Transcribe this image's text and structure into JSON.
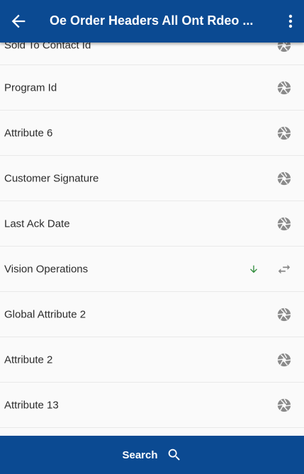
{
  "header": {
    "title": "Oe Order Headers All Ont Rdeo  ...",
    "back_icon": "arrow-left-icon",
    "menu_icon": "more-vert-icon"
  },
  "rows": [
    {
      "label": "Sold To Contact Id",
      "icon": "aperture-icon"
    },
    {
      "label": "Program Id",
      "icon": "aperture-icon"
    },
    {
      "label": "Attribute 6",
      "icon": "aperture-icon"
    },
    {
      "label": "Customer Signature",
      "icon": "aperture-icon"
    },
    {
      "label": "Last Ack Date",
      "icon": "aperture-icon"
    },
    {
      "label": "Vision Operations",
      "icon": "swap-horiz-icon",
      "sort_icon": "arrow-down-icon"
    },
    {
      "label": "Global Attribute 2",
      "icon": "aperture-icon"
    },
    {
      "label": "Attribute 2",
      "icon": "aperture-icon"
    },
    {
      "label": "Attribute 13",
      "icon": "aperture-icon"
    }
  ],
  "footer": {
    "search_label": "Search",
    "icon": "search-icon"
  },
  "colors": {
    "primary": "#0b4a92",
    "icon_gray": "#8a8a8a",
    "sort_green": "#2e8b3a"
  }
}
